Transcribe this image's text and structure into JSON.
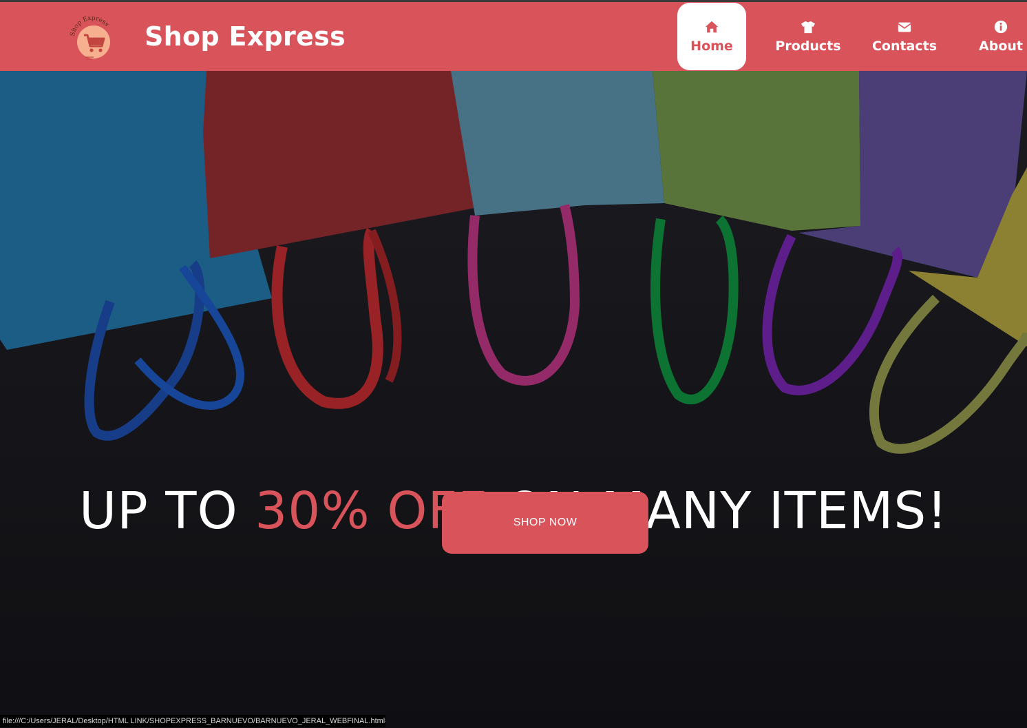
{
  "brand": {
    "name": "Shop Express",
    "logo_text": "Shop Express",
    "logo_icon": "shopping-cart-icon"
  },
  "nav": {
    "items": [
      {
        "label": "Home",
        "icon": "home-icon",
        "active": true
      },
      {
        "label": "Products",
        "icon": "tshirt-icon",
        "active": false
      },
      {
        "label": "Contacts",
        "icon": "envelope-icon",
        "active": false
      },
      {
        "label": "About",
        "icon": "info-icon",
        "active": false
      }
    ]
  },
  "hero": {
    "headline_prefix": "UP TO ",
    "headline_highlight": "30% OFF",
    "headline_suffix": " ON MANY ITEMS!",
    "cta_label": "SHOP NOW"
  },
  "status_bar": {
    "url": "file:///C:/Users/JERAL/Desktop/HTML LINK/SHOPEXPRESS_BARNUEVO/BARNUEVO_JERAL_WEBFINAL.html#..."
  },
  "colors": {
    "accent": "#d9535b",
    "nav_text": "#ffffff",
    "hero_background": "#1a1a1d"
  }
}
